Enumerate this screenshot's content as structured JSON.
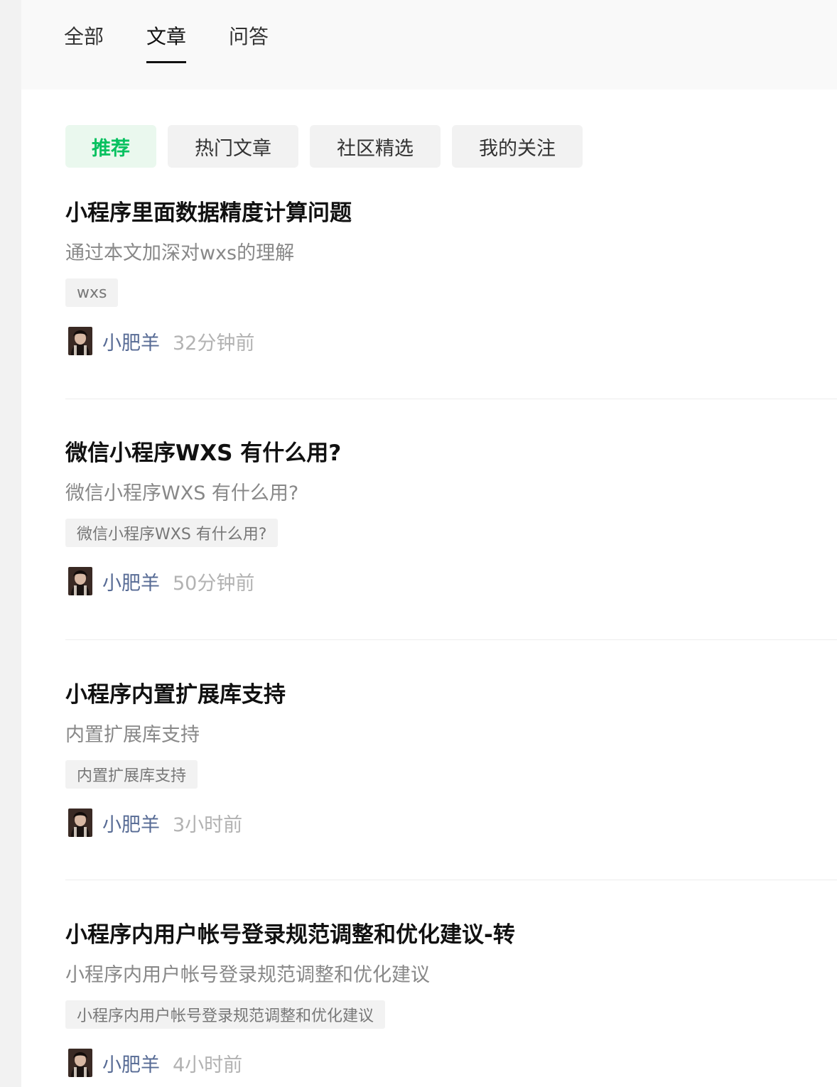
{
  "top_tabs": [
    {
      "label": "全部"
    },
    {
      "label": "文章"
    },
    {
      "label": "问答"
    }
  ],
  "active_top_tab": "文章",
  "filters": [
    {
      "label": "推荐"
    },
    {
      "label": "热门文章"
    },
    {
      "label": "社区精选"
    },
    {
      "label": "我的关注"
    }
  ],
  "active_filter": "推荐",
  "colors": {
    "accent_green": "#07c160",
    "author_blue": "#576b95"
  },
  "articles": [
    {
      "title": "小程序里面数据精度计算问题",
      "desc": "通过本文加深对wxs的理解",
      "tag": "wxs",
      "author": "小肥羊",
      "time": "32分钟前"
    },
    {
      "title": "微信小程序WXS 有什么用?",
      "desc": "微信小程序WXS 有什么用?",
      "tag": "微信小程序WXS 有什么用?",
      "author": "小肥羊",
      "time": "50分钟前"
    },
    {
      "title": "小程序内置扩展库支持",
      "desc": "内置扩展库支持",
      "tag": "内置扩展库支持",
      "author": "小肥羊",
      "time": "3小时前"
    },
    {
      "title": "小程序内用户帐号登录规范调整和优化建议-转",
      "desc": "小程序内用户帐号登录规范调整和优化建议",
      "tag": "小程序内用户帐号登录规范调整和优化建议",
      "author": "小肥羊",
      "time": "4小时前"
    }
  ]
}
